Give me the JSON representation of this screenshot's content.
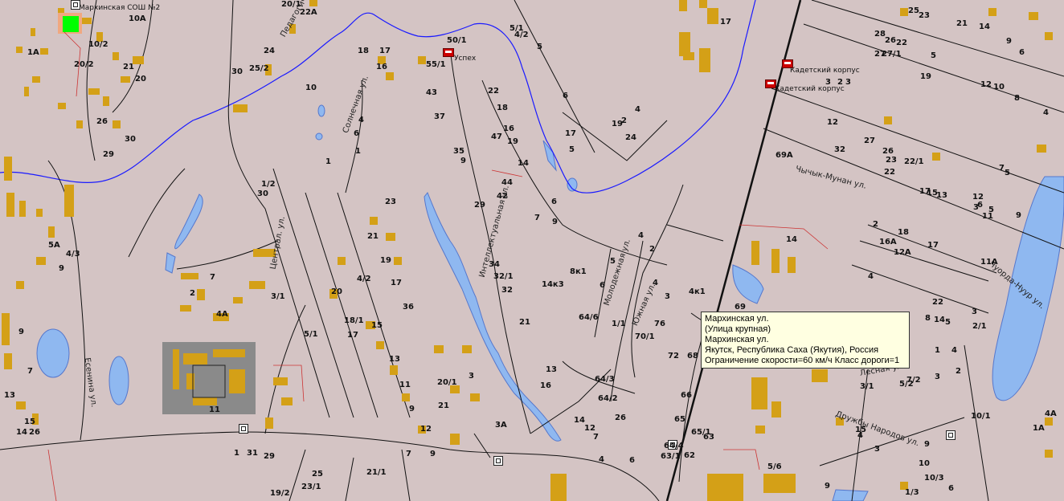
{
  "tooltip": {
    "line1": "Мархинская ул.",
    "line2": "(Улица крупная)",
    "line3": "Мархинская ул.",
    "line4": "Якутск, Республика Саха (Якутия), Россия",
    "line5": "Ограничение скорости=60 км/ч Класс дороги=1"
  },
  "places": {
    "school": "Мархинская СОШ №2",
    "uspekh": "Успех",
    "cadet1": "Кадетский корпус",
    "cadet2": "Кадетский корпус"
  },
  "streets": {
    "pedagogicheskaya": "Педагогическая ул.",
    "solnechnaya": "Солнечная ул.",
    "tsentralnaya": "Централ. ул.",
    "yesenina": "Есенина ул.",
    "intellektualnaya": "Интеллектуальная ул.",
    "molodezhnaya": "Молодежная ул.",
    "yuzhnaya": "Южная ул.",
    "chychyk": "Чычык-Мунан ул.",
    "chuordakh": "Чуорда-Нуур ул.",
    "druzhby": "Дружбы Народов ул.",
    "lesnaya": "Лесная ул."
  },
  "house_numbers": [
    "10А",
    "10/2",
    "20/2",
    "21",
    "20",
    "1А",
    "26",
    "30",
    "29",
    "22А",
    "20/1",
    "24",
    "25/2",
    "30",
    "18",
    "17",
    "16",
    "50/1",
    "55/1",
    "5/1",
    "4/2",
    "5",
    "17",
    "25",
    "23",
    "21",
    "14",
    "9",
    "6",
    "28",
    "26",
    "22",
    "27",
    "27/1",
    "5",
    "19",
    "12",
    "10",
    "8",
    "4",
    "3",
    "3",
    "2",
    "6",
    "4",
    "2",
    "19",
    "17",
    "5",
    "24",
    "22",
    "18",
    "16",
    "19",
    "47",
    "43",
    "37",
    "35",
    "9",
    "10",
    "6",
    "4",
    "1",
    "1",
    "1/2",
    "30",
    "14",
    "44",
    "42",
    "6",
    "7",
    "9",
    "29",
    "23",
    "21",
    "19",
    "17",
    "36",
    "34",
    "32/1",
    "32",
    "21",
    "4/2",
    "5А",
    "4/3",
    "9",
    "7",
    "2",
    "3/1",
    "4А",
    "9",
    "7",
    "13",
    "15",
    "14",
    "26",
    "20",
    "18/1",
    "17",
    "15",
    "13",
    "11",
    "9",
    "12",
    "20/1",
    "21",
    "3",
    "5/1",
    "4",
    "2",
    "5",
    "6",
    "4",
    "3",
    "76",
    "4к1",
    "8к1",
    "14к3",
    "64/6",
    "1/1",
    "70/1",
    "72",
    "68",
    "66",
    "65",
    "65/1",
    "63",
    "62",
    "63/1",
    "64/4",
    "64/3",
    "64/2",
    "26",
    "13",
    "16",
    "14",
    "12",
    "7",
    "4",
    "6",
    "3А",
    "7",
    "9",
    "11",
    "1",
    "31",
    "29",
    "25",
    "19/2",
    "23/1",
    "21/1",
    "14",
    "69А",
    "12",
    "32",
    "27",
    "26",
    "23",
    "22/1",
    "22",
    "7",
    "5",
    "17",
    "15",
    "13",
    "12",
    "6",
    "5",
    "3",
    "11",
    "9",
    "2",
    "18",
    "16А",
    "17",
    "12А",
    "11А",
    "4",
    "22",
    "8",
    "14",
    "5",
    "3",
    "2/1",
    "1",
    "4",
    "2",
    "3",
    "7/2",
    "5/2",
    "3/1",
    "10/1",
    "4",
    "9",
    "10",
    "10/3",
    "6",
    "1/3",
    "5/6",
    "69",
    "1А",
    "4А",
    "15",
    "9",
    "3",
    "5"
  ],
  "colors": {
    "background": "#d4c4c4",
    "building": "#d4a017",
    "water": "#8fb8f0",
    "river": "#1a1aff",
    "road": "#000000",
    "tooltip_bg": "#ffffe1"
  }
}
